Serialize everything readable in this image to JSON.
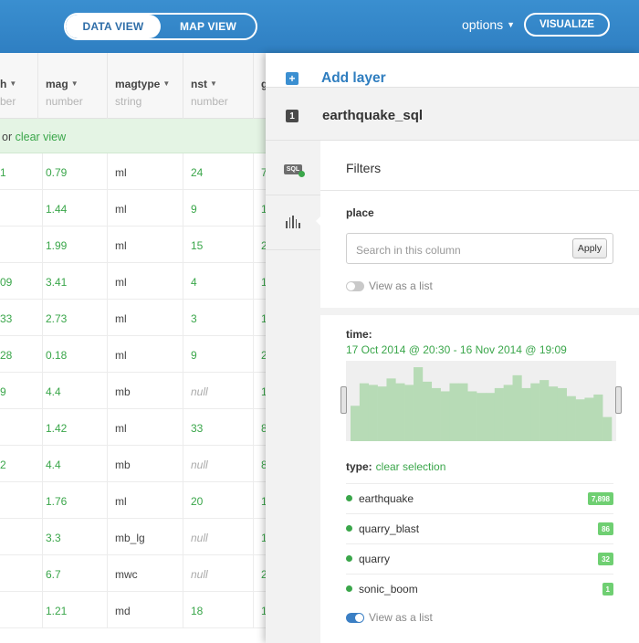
{
  "header": {
    "toggle": {
      "data_view": "DATA VIEW",
      "map_view": "MAP VIEW"
    },
    "options_label": "options",
    "visualize_label": "VISUALIZE"
  },
  "table": {
    "columns": [
      {
        "name": "h",
        "type": "ber"
      },
      {
        "name": "mag",
        "type": "number"
      },
      {
        "name": "magtype",
        "type": "string"
      },
      {
        "name": "nst",
        "type": "number"
      },
      {
        "name": "g",
        "type": ""
      }
    ],
    "notice": {
      "prefix": "or ",
      "link": "clear view"
    },
    "rows": [
      [
        "1",
        "0.79",
        "ml",
        "24",
        "7"
      ],
      [
        "",
        "1.44",
        "ml",
        "9",
        "1"
      ],
      [
        "",
        "1.99",
        "ml",
        "15",
        "2"
      ],
      [
        "09",
        "3.41",
        "ml",
        "4",
        "1"
      ],
      [
        "33",
        "2.73",
        "ml",
        "3",
        "1"
      ],
      [
        "28",
        "0.18",
        "ml",
        "9",
        "2"
      ],
      [
        "9",
        "4.4",
        "mb",
        "null",
        "1"
      ],
      [
        "",
        "1.42",
        "ml",
        "33",
        "8"
      ],
      [
        "2",
        "4.4",
        "mb",
        "null",
        "8"
      ],
      [
        "",
        "1.76",
        "ml",
        "20",
        "1"
      ],
      [
        "",
        "3.3",
        "mb_lg",
        "null",
        "1"
      ],
      [
        "",
        "6.7",
        "mwc",
        "null",
        "2"
      ],
      [
        "",
        "1.21",
        "md",
        "18",
        "1"
      ]
    ]
  },
  "panel": {
    "add_layer": "Add layer",
    "layer_number": "1",
    "layer_name": "earthquake_sql",
    "filters_title": "Filters",
    "place": {
      "label": "place",
      "placeholder": "Search in this column",
      "apply": "Apply",
      "view_as_list": "View as a list"
    },
    "time": {
      "label": "time:",
      "range": "17 Oct 2014 @ 20:30 - 16 Nov 2014 @ 19:09",
      "histogram": [
        0.44,
        0.72,
        0.7,
        0.68,
        0.78,
        0.72,
        0.7,
        0.92,
        0.74,
        0.66,
        0.62,
        0.72,
        0.72,
        0.62,
        0.6,
        0.6,
        0.66,
        0.7,
        0.82,
        0.66,
        0.72,
        0.76,
        0.68,
        0.66,
        0.56,
        0.52,
        0.54,
        0.58,
        0.3
      ]
    },
    "type": {
      "label": "type:",
      "clear": "clear selection",
      "items": [
        {
          "name": "earthquake",
          "count": "7,898"
        },
        {
          "name": "quarry_blast",
          "count": "86"
        },
        {
          "name": "quarry",
          "count": "32"
        },
        {
          "name": "sonic_boom",
          "count": "1"
        }
      ],
      "view_as_list": "View as a list"
    },
    "colors": {
      "accent_green": "#3aa64a",
      "histogram_fill": "#b7dbb6",
      "brand_blue": "#2f7fc2"
    }
  }
}
